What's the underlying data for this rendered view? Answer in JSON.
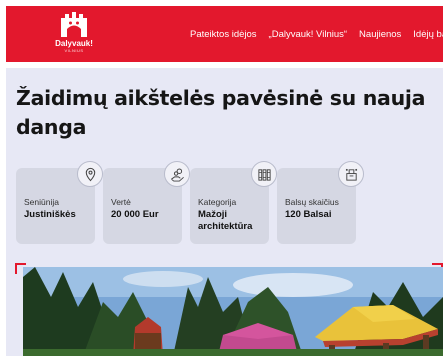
{
  "header": {
    "logo": {
      "title": "Dalyvauk!",
      "subtitle": "VILNIUS",
      "icon": "castle-logo-icon"
    },
    "nav": [
      {
        "label": "Pateiktos idėjos"
      },
      {
        "label": "„Dalyvauk! Vilnius“"
      },
      {
        "label": "Naujienos"
      },
      {
        "label": "Idėjų bankas"
      }
    ]
  },
  "page": {
    "title": "Žaidimų aikštelės pavėsinė su nauja danga"
  },
  "cards": [
    {
      "icon": "map-pin-icon",
      "label": "Seniūnija",
      "value": "Justiniškės"
    },
    {
      "icon": "hand-coins-icon",
      "label": "Vertė",
      "value": "20 000 Eur"
    },
    {
      "icon": "books-icon",
      "label": "Kategorija",
      "value": "Mažoji architektūra"
    },
    {
      "icon": "ballot-box-icon",
      "label": "Balsų skaičius",
      "value": "120 Balsai"
    }
  ],
  "colors": {
    "brand_red": "#e3182d",
    "content_bg": "#e7e8f5",
    "card_bg": "#d5d7e3"
  }
}
